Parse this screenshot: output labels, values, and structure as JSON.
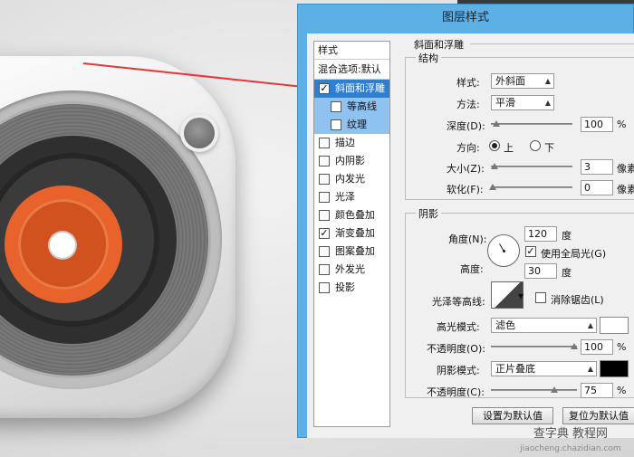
{
  "dialog": {
    "title": "图层样式",
    "styles_header": "样式",
    "blend_options": "混合选项:默认",
    "style_items": [
      {
        "label": "斜面和浮雕",
        "checked": true,
        "selected": true,
        "sub": false
      },
      {
        "label": "等高线",
        "checked": false,
        "selected": false,
        "sub": true
      },
      {
        "label": "纹理",
        "checked": false,
        "selected": false,
        "sub": true
      },
      {
        "label": "描边",
        "checked": false,
        "selected": false,
        "sub": false
      },
      {
        "label": "内阴影",
        "checked": false,
        "selected": false,
        "sub": false
      },
      {
        "label": "内发光",
        "checked": false,
        "selected": false,
        "sub": false
      },
      {
        "label": "光泽",
        "checked": false,
        "selected": false,
        "sub": false
      },
      {
        "label": "颜色叠加",
        "checked": false,
        "selected": false,
        "sub": false
      },
      {
        "label": "渐变叠加",
        "checked": true,
        "selected": false,
        "sub": false
      },
      {
        "label": "图案叠加",
        "checked": false,
        "selected": false,
        "sub": false
      },
      {
        "label": "外发光",
        "checked": false,
        "selected": false,
        "sub": false
      },
      {
        "label": "投影",
        "checked": false,
        "selected": false,
        "sub": false
      }
    ],
    "section_title": "斜面和浮雕",
    "structure": {
      "legend": "结构",
      "style_label": "样式:",
      "style_value": "外斜面",
      "technique_label": "方法:",
      "technique_value": "平滑",
      "depth_label": "深度(D):",
      "depth_value": "100",
      "depth_unit": "%",
      "direction_label": "方向:",
      "dir_up": "上",
      "dir_down": "下",
      "size_label": "大小(Z):",
      "size_value": "3",
      "size_unit": "像素",
      "soften_label": "软化(F):",
      "soften_value": "0",
      "soften_unit": "像素"
    },
    "shading": {
      "legend": "阴影",
      "angle_label": "角度(N):",
      "angle_value": "120",
      "angle_unit": "度",
      "global_light": "使用全局光(G)",
      "altitude_label": "高度:",
      "altitude_value": "30",
      "altitude_unit": "度",
      "gloss_label": "光泽等高线:",
      "anti_alias": "消除锯齿(L)",
      "highlight_mode_label": "高光模式:",
      "highlight_mode_value": "滤色",
      "highlight_color": "#ffffff",
      "highlight_opacity_label": "不透明度(O):",
      "highlight_opacity_value": "100",
      "shadow_mode_label": "阴影模式:",
      "shadow_mode_value": "正片叠底",
      "shadow_color": "#000000",
      "shadow_opacity_label": "不透明度(C):",
      "shadow_opacity_value": "75",
      "pct": "%"
    },
    "btn_default": "设置为默认值",
    "btn_reset": "复位为默认值"
  },
  "watermark": {
    "line1": "查字典 教程网",
    "line2": "jiaocheng.chazidian.com"
  },
  "colors": {
    "titlebar": "#5cb0e6",
    "selection": "#2e7fd2",
    "arrow": "#e8363a",
    "speaker_orange": "#e8622c"
  }
}
